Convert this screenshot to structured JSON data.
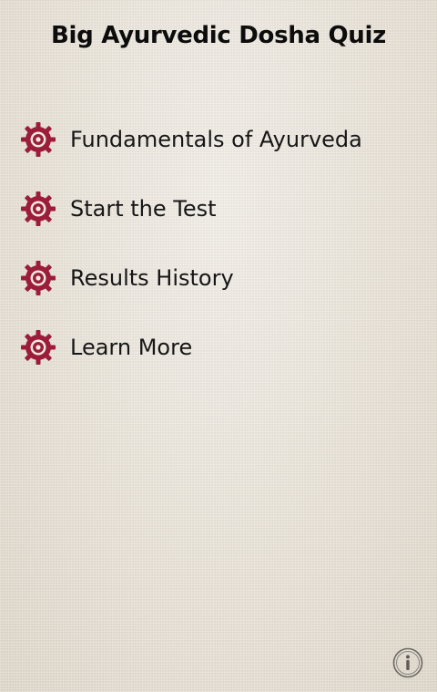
{
  "header": {
    "title": "Big Ayurvedic Dosha Quiz"
  },
  "menu": {
    "items": [
      {
        "label": "Fundamentals of Ayurveda",
        "icon": "gear-icon"
      },
      {
        "label": "Start the Test",
        "icon": "gear-icon"
      },
      {
        "label": "Results History",
        "icon": "gear-icon"
      },
      {
        "label": "Learn More",
        "icon": "gear-icon"
      }
    ]
  },
  "footer": {
    "info_icon": "info-icon"
  },
  "colors": {
    "accent": "#9b1d3a",
    "background": "#e9e3d9",
    "text": "#161616"
  }
}
